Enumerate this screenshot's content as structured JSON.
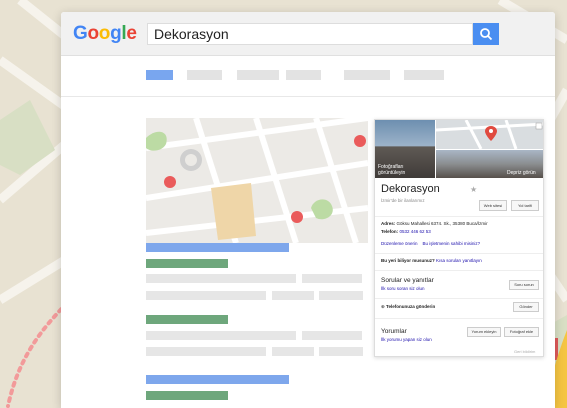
{
  "search": {
    "logo_letters": [
      {
        "ch": "G",
        "color": "#4285F4"
      },
      {
        "ch": "o",
        "color": "#EA4335"
      },
      {
        "ch": "o",
        "color": "#FBBC05"
      },
      {
        "ch": "g",
        "color": "#4285F4"
      },
      {
        "ch": "l",
        "color": "#34A853"
      },
      {
        "ch": "e",
        "color": "#EA4335"
      }
    ],
    "query": "Dekorasyon",
    "button_icon": "search-icon"
  },
  "panel": {
    "photo_label": "Fotoğrafları görüntüleyin",
    "street_label": "Depriz görün",
    "title": "Dekorasyon",
    "subtitle": "İzmir'de bir ilanlarımız",
    "website_button": "Web sitesi",
    "directions_button": "Yol tarifi",
    "address_label": "Adres:",
    "address_value": "Göksu Mahallesi 6374. Sk., 35380 Buca/İzmir",
    "phone_label": "Telefon:",
    "phone_value": "0532 446 62 53",
    "suggest_edit": "Düzenleme önerin",
    "own_business": "Bu işletmenin sahibi misiniz?",
    "know_place": "Bu yeri biliyor musunuz?",
    "quick_questions": "Kısa soruları yanıtlayın",
    "qa_title": "Sorular ve yanıtlar",
    "qa_sub": "İlk soru soran siz olun",
    "qa_button": "Soru sorun",
    "send_phone": "Telefonunuza gönderin",
    "send_button": "Gönder",
    "reviews_title": "Yorumlar",
    "reviews_sub": "İlk yorumu yapan siz olun",
    "write_review_button": "Yorum ekleyin",
    "add_photo_button": "Fotoğraf ekle",
    "footer": "Geri bildirim"
  },
  "colors": {
    "accent_blue": "#4a8ef1",
    "result_blue": "#7ea7ec",
    "result_green": "#6ea77c",
    "deco_red": "#e05a5a",
    "deco_pink": "#f29a9a",
    "deco_yellow": "#f5c542"
  }
}
